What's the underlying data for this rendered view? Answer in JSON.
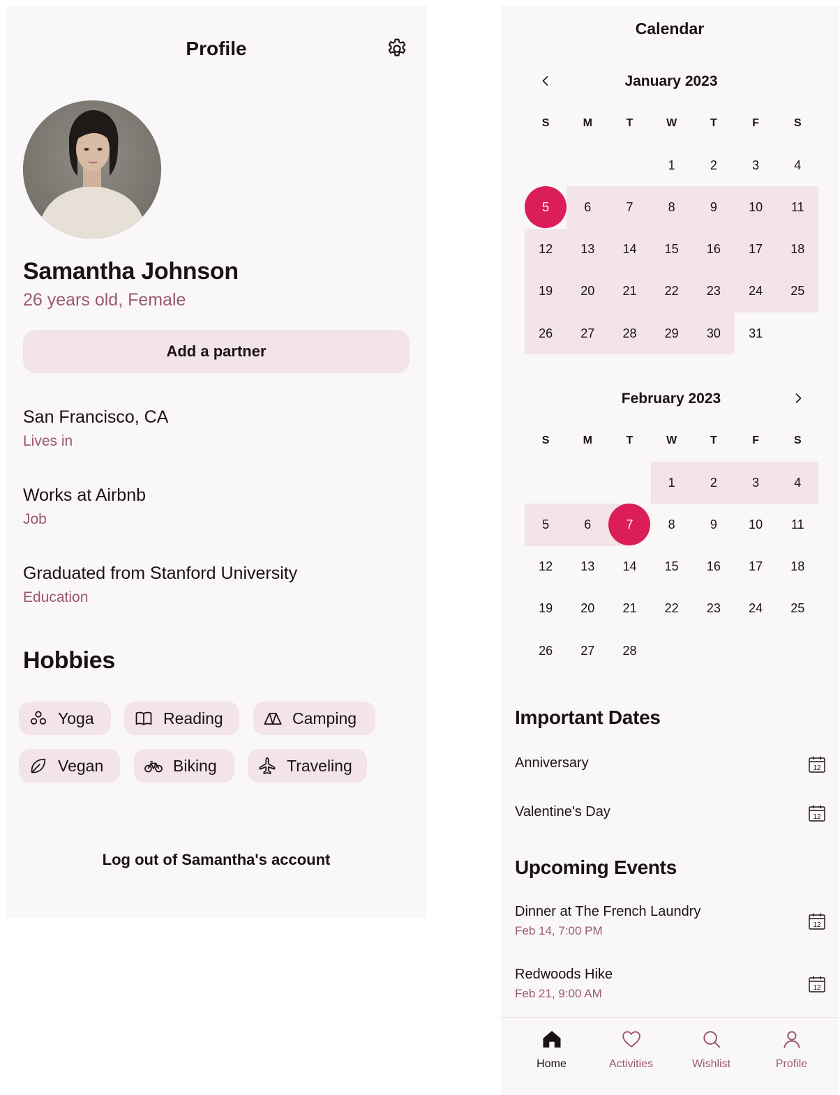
{
  "profile": {
    "title": "Profile",
    "name": "Samantha Johnson",
    "subinfo": "26 years old, Female",
    "partner_button": "Add a partner",
    "info": [
      {
        "value": "San Francisco, CA",
        "label": "Lives in"
      },
      {
        "value": "Works at Airbnb",
        "label": "Job"
      },
      {
        "value": "Graduated from Stanford University",
        "label": "Education"
      }
    ],
    "hobbies_title": "Hobbies",
    "hobbies": [
      {
        "label": "Yoga",
        "icon": "yoga-icon"
      },
      {
        "label": "Reading",
        "icon": "book-icon"
      },
      {
        "label": "Camping",
        "icon": "tent-icon"
      },
      {
        "label": "Vegan",
        "icon": "leaf-icon"
      },
      {
        "label": "Biking",
        "icon": "bike-icon"
      },
      {
        "label": "Traveling",
        "icon": "plane-icon"
      }
    ],
    "logout": "Log out of Samantha's account"
  },
  "calendar": {
    "title": "Calendar",
    "weekdays": [
      "S",
      "M",
      "T",
      "W",
      "T",
      "F",
      "S"
    ],
    "months": [
      {
        "title": "January 2023",
        "first_weekday": 3,
        "days": 31,
        "range_start": 5,
        "range_end": 30,
        "selected": 5
      },
      {
        "title": "February 2023",
        "first_weekday": 3,
        "days": 28,
        "range_start": 1,
        "range_end": 7,
        "selected": 7
      }
    ],
    "important_title": "Important Dates",
    "important": [
      {
        "label": "Anniversary",
        "icon": "calendar-12-icon"
      },
      {
        "label": "Valentine's Day",
        "icon": "calendar-12-icon"
      }
    ],
    "upcoming_title": "Upcoming Events",
    "upcoming": [
      {
        "label": "Dinner at The French Laundry",
        "time": "Feb 14, 7:00 PM",
        "icon": "calendar-12-icon"
      },
      {
        "label": "Redwoods Hike",
        "time": "Feb 21, 9:00 AM",
        "icon": "calendar-12-icon"
      }
    ],
    "calendar_icon_number": "12"
  },
  "nav": [
    {
      "label": "Home",
      "icon": "home-icon",
      "active": true
    },
    {
      "label": "Activities",
      "icon": "heart-icon",
      "active": false
    },
    {
      "label": "Wishlist",
      "icon": "search-icon",
      "active": false
    },
    {
      "label": "Profile",
      "icon": "user-icon",
      "active": false
    }
  ],
  "colors": {
    "accent": "#db1d58",
    "range": "#f2e4e8",
    "muted": "#9b5a6c",
    "panel": "#f9f7f8"
  }
}
